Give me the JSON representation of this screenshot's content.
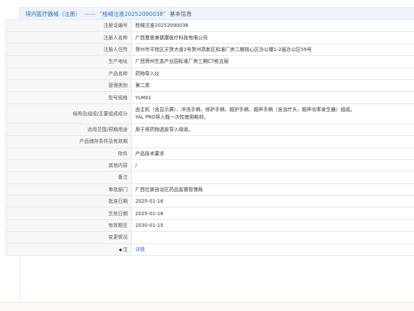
{
  "header": {
    "category": "境内医疗器械（注册）",
    "dash": "——",
    "reg_no_quoted": "“桂械注准20252090038”",
    "suffix": "基本信息"
  },
  "rows": [
    {
      "label": "注册证编号",
      "value": "桂械注准20252090038"
    },
    {
      "label": "注册人名称",
      "value": "广西慧思美健康医疗科技有限公司"
    },
    {
      "label": "注册人住所",
      "value": "贺州市平桂区天贺大道1号贺州高新区标准厂房二期核心区办公楼1-2层办公区59号"
    },
    {
      "label": "生产地址",
      "value": "广西贺州生态产业园标准厂房三期C7栋五层"
    },
    {
      "label": "产品名称",
      "value": "药物导入仪"
    },
    {
      "label": "管理类别",
      "value": "第二类"
    },
    {
      "label": "型号规格",
      "value": "YLM01"
    },
    {
      "label": "结构及组成/主要组成成分",
      "value": "由主机（含显示屏）、冲洗手柄、修护手柄、超护手柄、超声手柄（含治疗头、超声功率发生器）组成。\nYAL PRO导入瓶一次性使用耗材。"
    },
    {
      "label": "适用范围/预期用途",
      "value": "用于将药物透皮导入吸收。"
    },
    {
      "label": "产品储存条件及有效期",
      "value": ""
    },
    {
      "label": "附件",
      "value": "产品技术要求"
    },
    {
      "label": "其他内容",
      "value": "/"
    },
    {
      "label": "备注",
      "value": ""
    },
    {
      "label": "审批部门",
      "value": "广西壮族自治区药品监督管理局"
    },
    {
      "label": "批准日期",
      "value": "2025-01-16"
    },
    {
      "label": "生效日期",
      "value": "2025-01-16"
    },
    {
      "label": "有效期至",
      "value": "2030-01-15"
    },
    {
      "label": "变更情况",
      "value": ""
    },
    {
      "label": "注",
      "value": "详情",
      "star": "◆"
    }
  ]
}
